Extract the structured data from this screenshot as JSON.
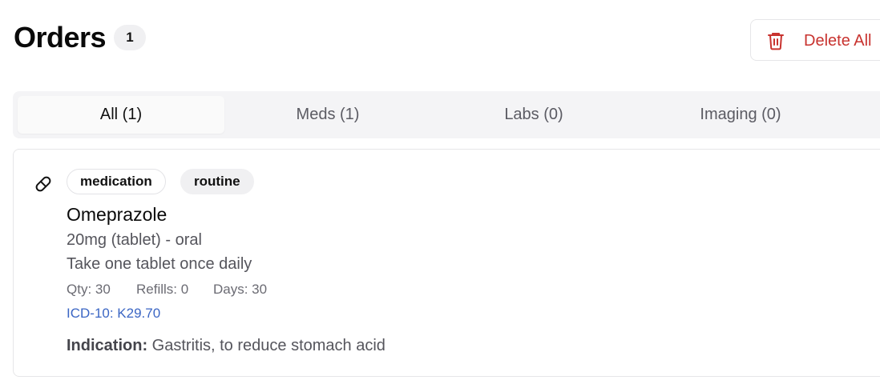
{
  "header": {
    "title": "Orders",
    "count": "1",
    "delete_all_label": "Delete All"
  },
  "tabs": [
    {
      "label": "All (1)",
      "active": true
    },
    {
      "label": "Meds (1)",
      "active": false
    },
    {
      "label": "Labs (0)",
      "active": false
    },
    {
      "label": "Imaging (0)",
      "active": false
    }
  ],
  "orders": [
    {
      "icon": "pill-icon",
      "tags": [
        "medication",
        "routine"
      ],
      "name": "Omeprazole",
      "dose": "20mg (tablet) - oral",
      "instructions": "Take one tablet once daily",
      "qty": "Qty: 30",
      "refills": "Refills: 0",
      "days": "Days: 30",
      "icd": "ICD-10: K29.70",
      "indication_label": "Indication:",
      "indication_text": "Gastritis, to reduce stomach acid"
    }
  ],
  "colors": {
    "danger": "#c8332f",
    "link": "#3b66c4",
    "tab_bg": "#f4f4f6",
    "muted_text": "#55555c"
  }
}
